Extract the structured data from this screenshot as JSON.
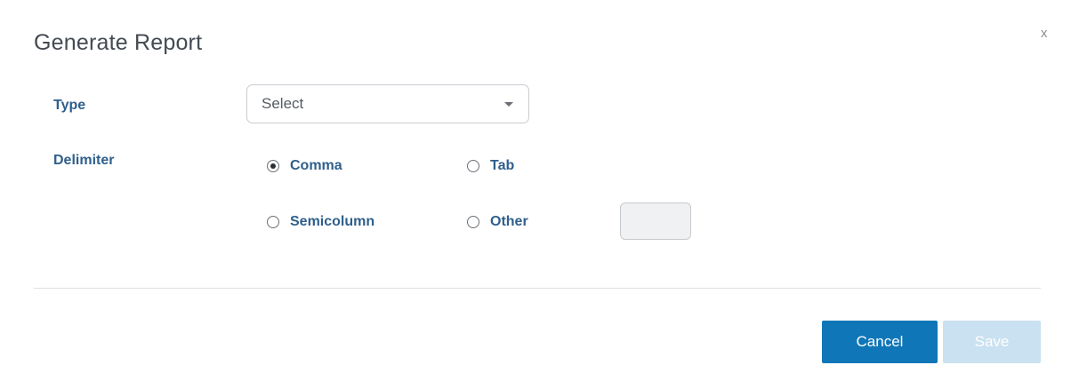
{
  "dialog": {
    "title": "Generate Report",
    "close_label": "x"
  },
  "type_field": {
    "label": "Type",
    "selected_value": "Select"
  },
  "delimiter_field": {
    "label": "Delimiter",
    "options": [
      {
        "label": "Comma",
        "checked": true
      },
      {
        "label": "Tab",
        "checked": false
      },
      {
        "label": "Semicolumn",
        "checked": false
      },
      {
        "label": "Other",
        "checked": false
      }
    ],
    "other_value": ""
  },
  "footer": {
    "cancel_label": "Cancel",
    "save_label": "Save"
  },
  "colors": {
    "primary": "#0f76b8",
    "primary_disabled": "#c9e1f0",
    "label": "#2f5f8c"
  }
}
